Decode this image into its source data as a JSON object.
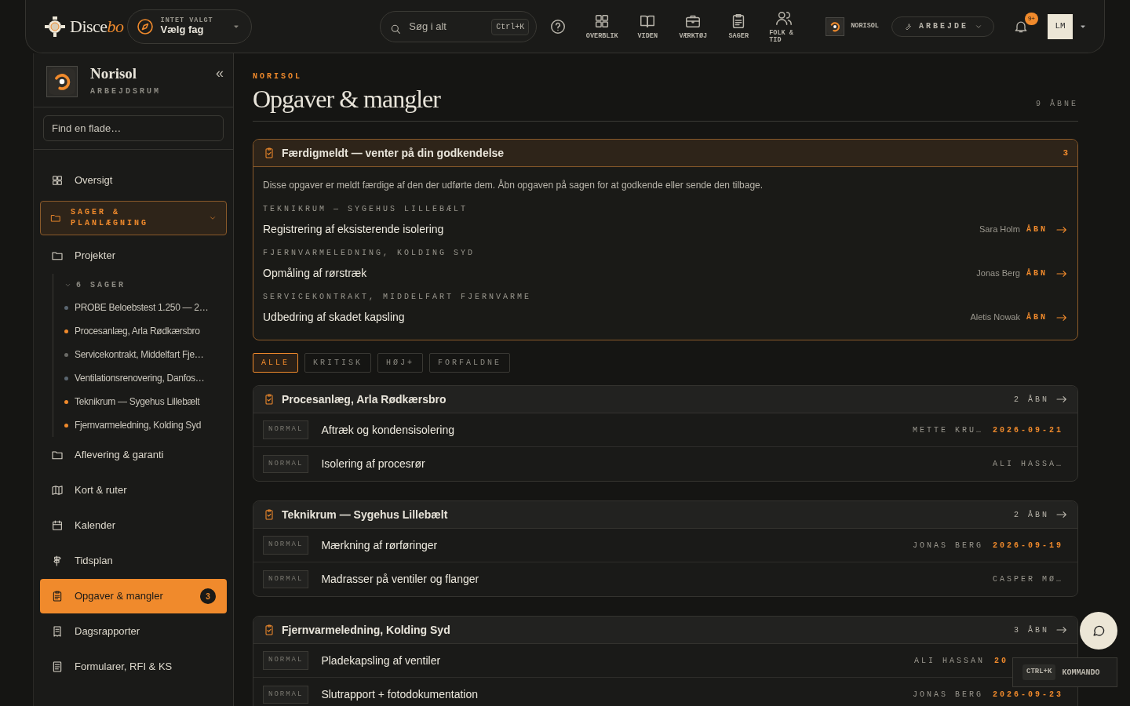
{
  "brand": {
    "name": "Disce",
    "name_accent": "bo"
  },
  "trade_picker": {
    "caption": "INTET VALGT",
    "value": "Vælg fag"
  },
  "search": {
    "placeholder": "Søg i alt",
    "shortcut": "Ctrl+K"
  },
  "nav_items": [
    {
      "label": "OVERBLIK"
    },
    {
      "label": "VIDEN"
    },
    {
      "label": "VÆRKTØJ"
    },
    {
      "label": "SAGER"
    },
    {
      "label": "FOLK & TID"
    }
  ],
  "workspace": {
    "name": "NORISOL"
  },
  "mode": {
    "label": "ARBEJDE"
  },
  "notifications": {
    "badge": "9+"
  },
  "user": {
    "initials": "LM"
  },
  "sidebar": {
    "title": "Norisol",
    "subtitle": "ARBEJDSRUM",
    "collapse": "«",
    "filter_placeholder": "Find en flade…",
    "items": [
      {
        "kind": "link",
        "label": "Oversigt",
        "selected": false
      },
      {
        "kind": "section",
        "label": "SAGER & PLANLÆGNING",
        "expanded": true
      },
      {
        "kind": "link",
        "label": "Projekter",
        "selected": false,
        "children_label": "6 SAGER",
        "children": [
          {
            "label": "PROBE Beloebstest 1.250 — 2…",
            "color": "#5a6670"
          },
          {
            "label": "Procesanlæg, Arla Rødkærsbro",
            "color": "#f08a2c"
          },
          {
            "label": "Servicekontrakt, Middelfart Fje…",
            "color": "#6a6a66"
          },
          {
            "label": "Ventilationsrenovering, Danfos…",
            "color": "#5a6670"
          },
          {
            "label": "Teknikrum — Sygehus Lillebælt",
            "color": "#f08a2c"
          },
          {
            "label": "Fjernvarmeledning, Kolding Syd",
            "color": "#f08a2c"
          }
        ]
      },
      {
        "kind": "link",
        "label": "Aflevering & garanti",
        "selected": false
      },
      {
        "kind": "link",
        "label": "Kort & ruter",
        "selected": false
      },
      {
        "kind": "link",
        "label": "Kalender",
        "selected": false
      },
      {
        "kind": "link",
        "label": "Tidsplan",
        "selected": false
      },
      {
        "kind": "link",
        "label": "Opgaver & mangler",
        "selected": true,
        "badge": "3"
      },
      {
        "kind": "link",
        "label": "Dagsrapporter",
        "selected": false
      },
      {
        "kind": "link",
        "label": "Formularer, RFI & KS",
        "selected": false
      }
    ]
  },
  "page": {
    "eyebrow": "NORISOL",
    "title": "Opgaver & mangler",
    "open_count": "9 ÅBNE"
  },
  "approval": {
    "title": "Færdigmeldt — venter på din godkendelse",
    "count": "3",
    "description": "Disse opgaver er meldt færdige af den der udførte dem. Åbn opgaven på sagen for at godkende eller sende den tilbage.",
    "items": [
      {
        "case": "TEKNIKRUM — SYGEHUS LILLEBÆLT",
        "task": "Registrering af eksisterende isolering",
        "person": "Sara Holm",
        "action": "ÅBN"
      },
      {
        "case": "FJERNVARMELEDNING, KOLDING SYD",
        "task": "Opmåling af rørstræk",
        "person": "Jonas Berg",
        "action": "ÅBN"
      },
      {
        "case": "SERVICEKONTRAKT, MIDDELFART FJERNVARME",
        "task": "Udbedring af skadet kapsling",
        "person": "Aletis Nowak",
        "action": "ÅBN"
      }
    ]
  },
  "filters": [
    {
      "label": "ALLE",
      "selected": true
    },
    {
      "label": "KRITISK",
      "selected": false
    },
    {
      "label": "HØJ+",
      "selected": false
    },
    {
      "label": "FORFALDNE",
      "selected": false
    }
  ],
  "groups": [
    {
      "title": "Procesanlæg, Arla Rødkærsbro",
      "count": "2 ÅBN",
      "rows": [
        {
          "priority": "NORMAL",
          "task": "Aftræk og kondensisolering",
          "assignee": "METTE KRU…",
          "due": "2026-09-21"
        },
        {
          "priority": "NORMAL",
          "task": "Isolering af procesrør",
          "assignee": "ALI HASSA…"
        }
      ]
    },
    {
      "title": "Teknikrum — Sygehus Lillebælt",
      "count": "2 ÅBN",
      "rows": [
        {
          "priority": "NORMAL",
          "task": "Mærkning af rørføringer",
          "assignee": "JONAS BERG",
          "due": "2026-09-19"
        },
        {
          "priority": "NORMAL",
          "task": "Madrasser på ventiler og flanger",
          "assignee": "CASPER MØ…"
        }
      ]
    },
    {
      "title": "Fjernvarmeledning, Kolding Syd",
      "count": "3 ÅBN",
      "rows": [
        {
          "priority": "NORMAL",
          "task": "Pladekapsling af ventiler",
          "assignee": "ALI HASSAN",
          "due": "20"
        },
        {
          "priority": "NORMAL",
          "task": "Slutrapport + fotodokumentation",
          "assignee": "JONAS BERG",
          "due": "2026-09-23"
        }
      ]
    }
  ],
  "command_hint": {
    "key": "CTRL+K",
    "label": "KOMMANDO"
  }
}
